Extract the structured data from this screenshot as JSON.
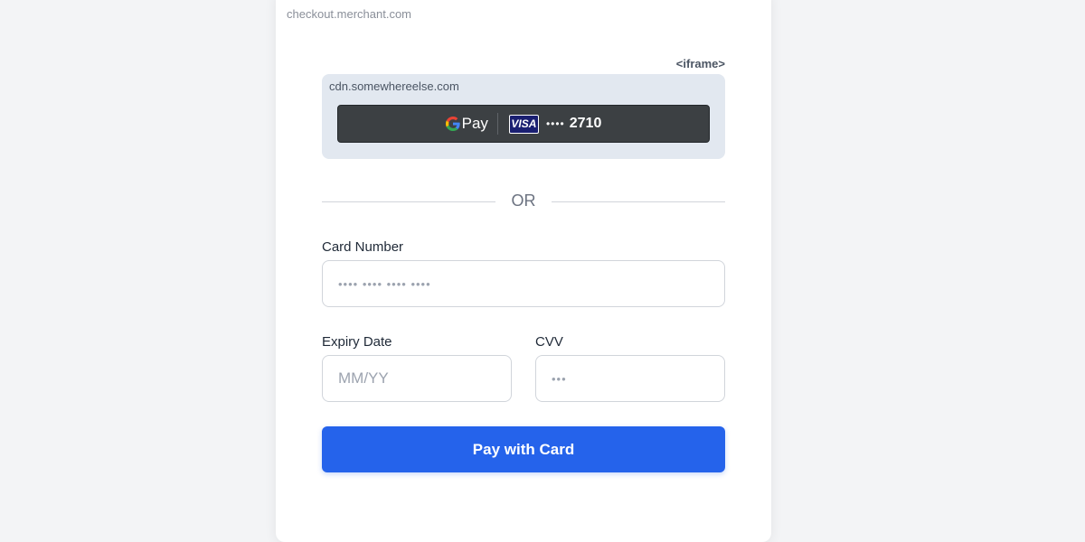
{
  "page": {
    "origin": "checkout.merchant.com"
  },
  "iframe": {
    "tag": "<iframe>",
    "origin": "cdn.somewhereelse.com",
    "gpay": {
      "pay_label": "Pay",
      "card_brand": "VISA",
      "masked_dots": "••••",
      "last4": "2710",
      "icon": "google-g-icon"
    }
  },
  "divider": {
    "text": "OR"
  },
  "form": {
    "card_number": {
      "label": "Card Number",
      "placeholder": "•••• •••• •••• ••••"
    },
    "expiry": {
      "label": "Expiry Date",
      "placeholder": "MM/YY"
    },
    "cvv": {
      "label": "CVV",
      "placeholder": "•••"
    },
    "submit_label": "Pay with Card"
  },
  "colors": {
    "accent": "#2563eb",
    "gpay_button": "#3c4043",
    "iframe_bg": "#e2e8f0",
    "visa_blue": "#1a1f71"
  }
}
